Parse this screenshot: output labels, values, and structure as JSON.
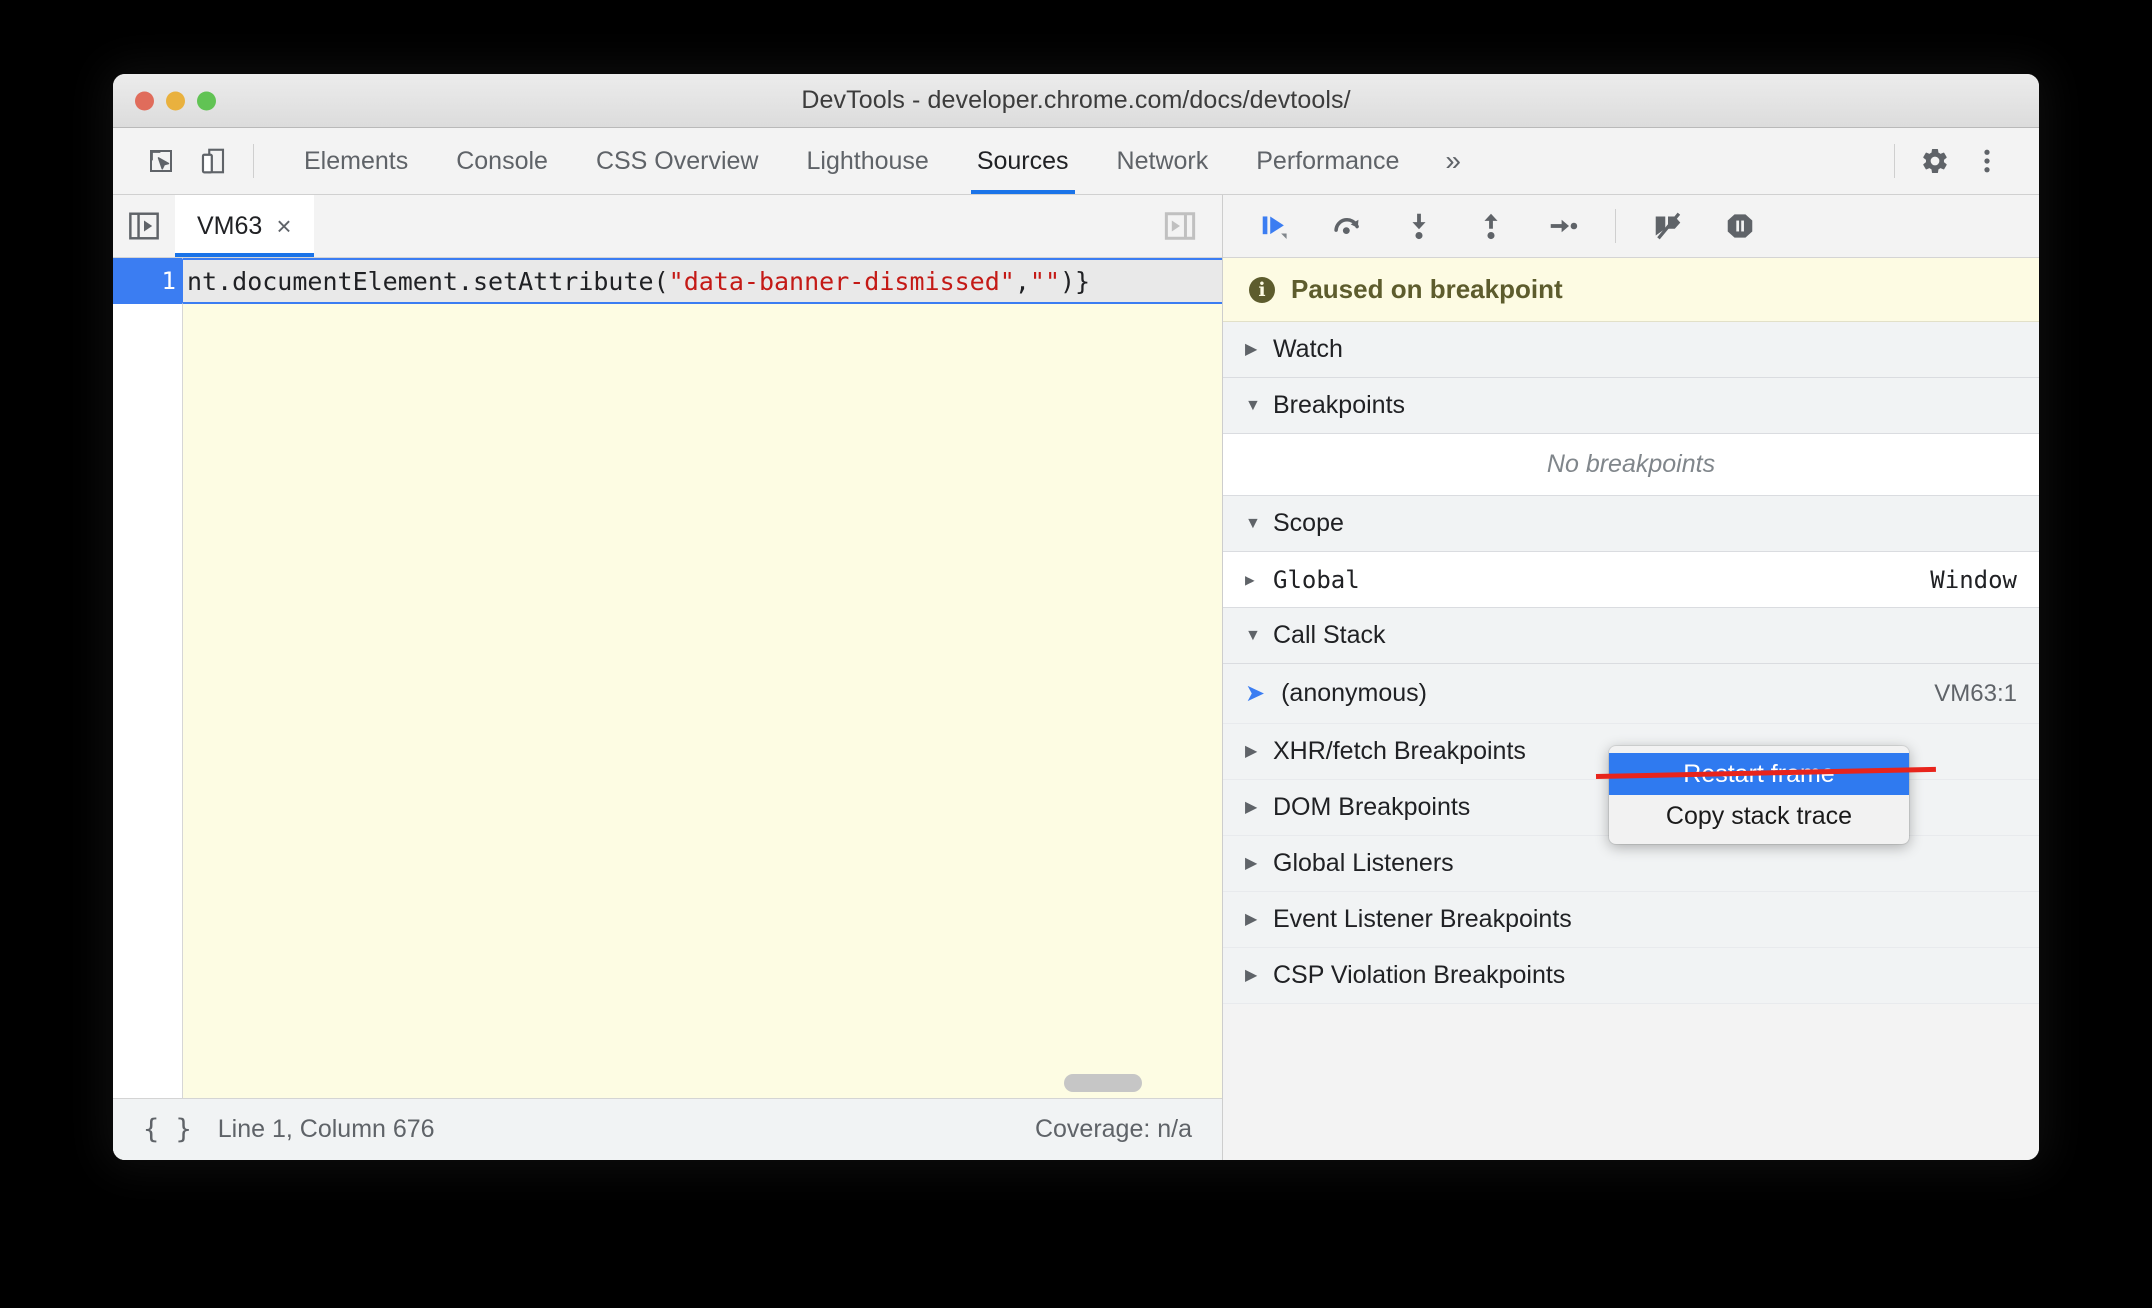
{
  "window": {
    "title": "DevTools - developer.chrome.com/docs/devtools/",
    "traffic": {
      "close": "close-button",
      "minimize": "minimize-button",
      "zoom": "zoom-button"
    }
  },
  "main_toolbar": {
    "inspect_icon": "inspect-element-icon",
    "device_icon": "device-toolbar-icon",
    "tabs": [
      {
        "label": "Elements",
        "active": false
      },
      {
        "label": "Console",
        "active": false
      },
      {
        "label": "CSS Overview",
        "active": false
      },
      {
        "label": "Lighthouse",
        "active": false
      },
      {
        "label": "Sources",
        "active": true
      },
      {
        "label": "Network",
        "active": false
      },
      {
        "label": "Performance",
        "active": false
      }
    ],
    "more_tabs": "»",
    "settings_icon": "gear-icon",
    "menu_icon": "kebab-menu-icon"
  },
  "file_tabs": {
    "navigator_toggle": "show-navigator-icon",
    "sidebar_toggle": "show-debugger-sidebar-icon",
    "open_file": "VM63",
    "close_glyph": "×"
  },
  "editor": {
    "line_number": "1",
    "code_prefix": "nt.documentElement.setAttribute(",
    "code_string": "\"data-banner-dismissed\"",
    "code_mid": ",",
    "code_string2": "\"\"",
    "code_suffix": ")}"
  },
  "statusbar": {
    "format_icon": "{ }",
    "position": "Line 1, Column 676",
    "coverage": "Coverage: n/a"
  },
  "debugger": {
    "toolbar": [
      {
        "name": "resume-script-execution-icon"
      },
      {
        "name": "step-over-next-function-call-icon"
      },
      {
        "name": "step-into-next-function-call-icon"
      },
      {
        "name": "step-out-of-current-function-icon"
      },
      {
        "name": "step-icon"
      },
      {
        "name": "deactivate-breakpoints-icon"
      },
      {
        "name": "pause-on-exceptions-icon"
      }
    ],
    "paused_banner": "Paused on breakpoint",
    "sections": {
      "watch": {
        "label": "Watch",
        "expanded": false
      },
      "breakpoints": {
        "label": "Breakpoints",
        "expanded": true,
        "empty_text": "No breakpoints"
      },
      "scope": {
        "label": "Scope",
        "expanded": true,
        "rows": [
          {
            "name": "Global",
            "value": "Window"
          }
        ]
      },
      "call_stack": {
        "label": "Call Stack",
        "expanded": true,
        "frames": [
          {
            "name": "(anonymous)",
            "location": "VM63:1"
          }
        ]
      },
      "other": [
        {
          "label": "XHR/fetch Breakpoints"
        },
        {
          "label": "DOM Breakpoints"
        },
        {
          "label": "Global Listeners"
        },
        {
          "label": "Event Listener Breakpoints"
        },
        {
          "label": "CSP Violation Breakpoints"
        }
      ]
    }
  },
  "context_menu": {
    "items": [
      {
        "label": "Restart frame",
        "selected": true,
        "struck_out": true
      },
      {
        "label": "Copy stack trace",
        "selected": false,
        "struck_out": false
      }
    ]
  },
  "colors": {
    "accent": "#1a73e8",
    "menu_highlight": "#2f7af0",
    "strike": "#e8241c",
    "paused_bg": "#fdfbe3",
    "editor_bg": "#fdfce3"
  }
}
